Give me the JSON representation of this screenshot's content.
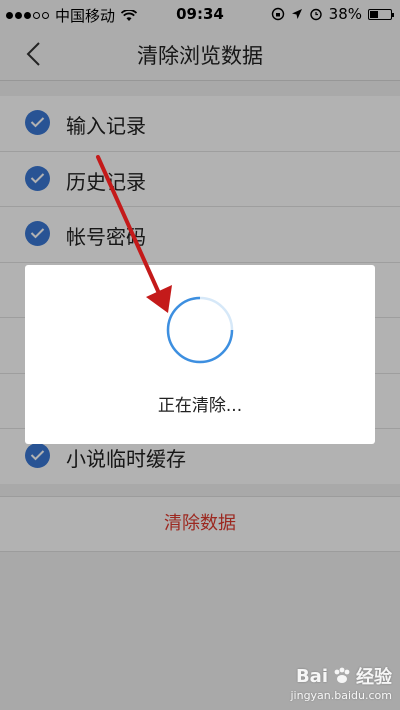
{
  "status_bar": {
    "carrier": "中国移动",
    "time": "09:34",
    "battery": "38%",
    "battery_level": 0.38,
    "signal_bars_filled": 3,
    "signal_bars_total": 5
  },
  "nav": {
    "title": "清除浏览数据",
    "back_icon": "chevron-left-icon"
  },
  "list": {
    "items": [
      {
        "label": "输入记录",
        "checked": true
      },
      {
        "label": "历史记录",
        "checked": true
      },
      {
        "label": "帐号密码",
        "checked": true
      },
      {
        "label": "",
        "checked": true
      },
      {
        "label": "",
        "checked": true
      },
      {
        "label": "",
        "checked": true
      },
      {
        "label": "小说临时缓存",
        "checked": true
      }
    ]
  },
  "clear_button": {
    "label": "清除数据"
  },
  "modal": {
    "message": "正在清除..."
  },
  "colors": {
    "accent_blue": "#3a78d4",
    "danger_red": "#e03a2e",
    "annotation_arrow": "#c41a1a"
  },
  "watermark": {
    "brand": "经验",
    "url": "jingyan.baidu.com"
  }
}
